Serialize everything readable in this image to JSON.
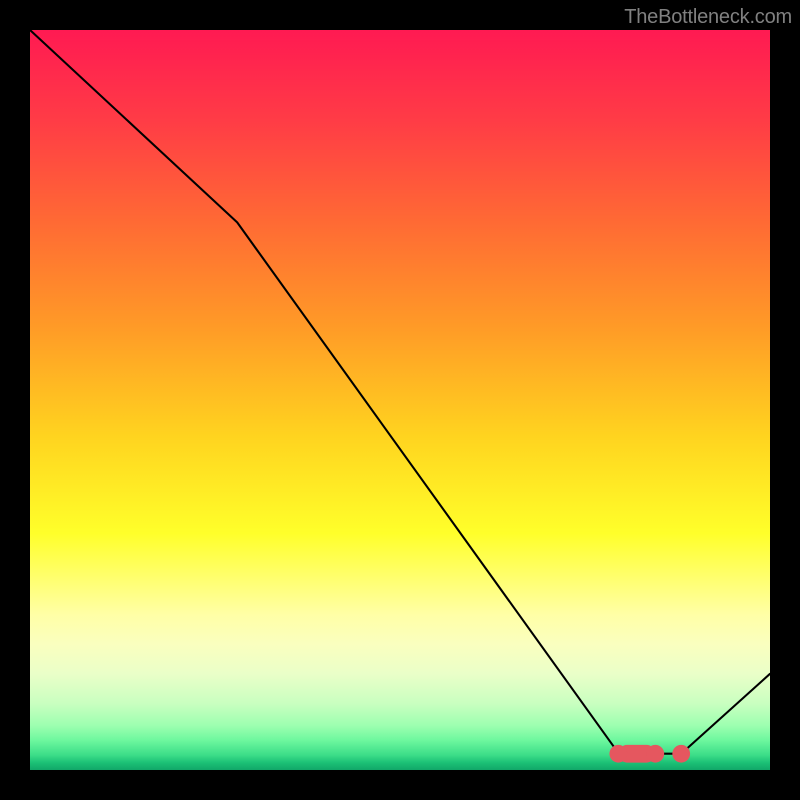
{
  "watermark": "TheBottleneck.com",
  "chart_data": {
    "type": "line",
    "title": "",
    "xlabel": "",
    "ylabel": "",
    "xlim": [
      0,
      100
    ],
    "ylim": [
      0,
      100
    ],
    "grid": false,
    "series": [
      {
        "name": "curve",
        "x": [
          0,
          28,
          79,
          81,
          85,
          88,
          100
        ],
        "y": [
          100,
          74,
          3,
          2.2,
          2.2,
          2.2,
          13
        ]
      }
    ],
    "markers": [
      {
        "shape": "pill",
        "x0": 79.5,
        "x1": 84.5,
        "y": 2.2,
        "radius": 1.2
      },
      {
        "shape": "dot",
        "x": 88.0,
        "y": 2.2,
        "radius": 1.2
      }
    ],
    "colors": {
      "line": "#000000",
      "marker_fill": "#e5575f"
    }
  }
}
